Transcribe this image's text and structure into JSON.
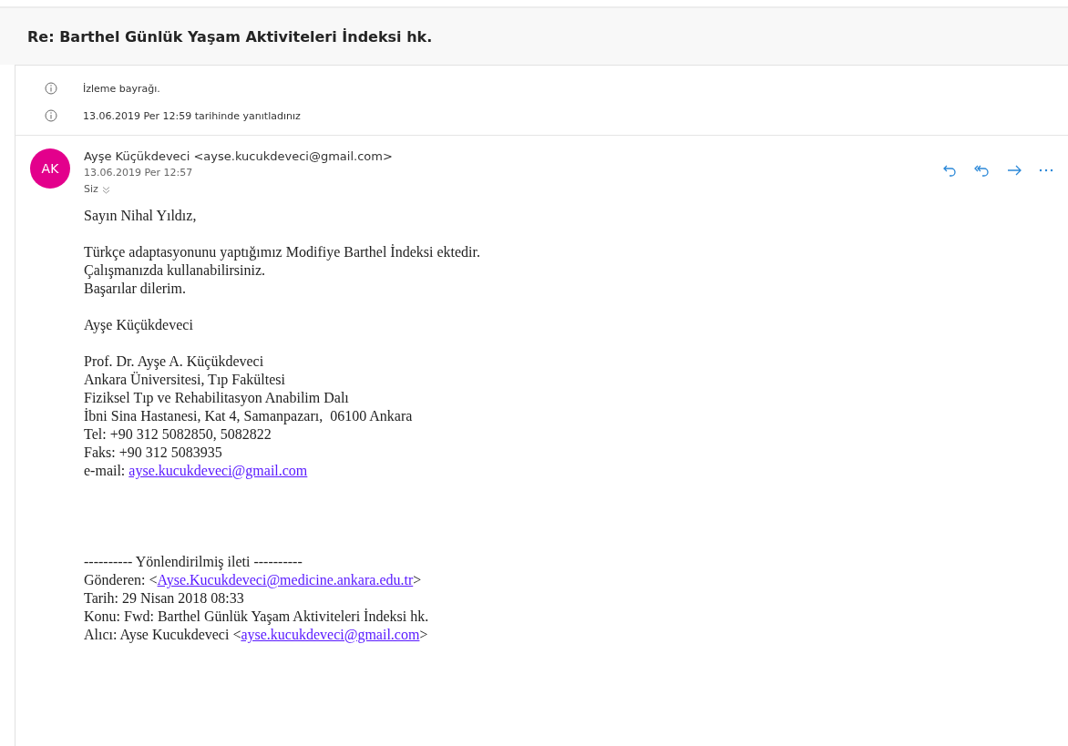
{
  "subject": "Re: Barthel Günlük Yaşam Aktiviteleri İndeksi hk.",
  "notices": [
    "İzleme bayrağı.",
    "13.06.2019 Per 12:59 tarihinde yanıtladınız"
  ],
  "message": {
    "initials": "AK",
    "sender": "Ayşe Küçükdeveci <ayse.kucukdeveci@gmail.com>",
    "date": "13.06.2019 Per 12:57",
    "recipient": "Siz",
    "paragraphs": [
      {
        "kind": "text",
        "lines": [
          {
            "text": "Sayın Nihal Yıldız,"
          }
        ]
      },
      {
        "kind": "text",
        "lines": [
          {
            "text": "Türkçe adaptasyonunu yaptığımız Modifiye Barthel İndeksi ektedir."
          },
          {
            "text": "Çalışmanızda kullanabilirsiniz."
          },
          {
            "text": "Başarılar dilerim."
          }
        ]
      },
      {
        "kind": "text",
        "lines": [
          {
            "text": "Ayşe Küçükdeveci"
          }
        ]
      },
      {
        "kind": "text",
        "lines": [
          {
            "text": "Prof. Dr. Ayşe A. Küçükdeveci"
          },
          {
            "text": "Ankara Üniversitesi, Tıp Fakültesi"
          },
          {
            "text": "Fiziksel Tıp ve Rehabilitasyon Anabilim Dalı"
          },
          {
            "text": "İbni Sina Hastanesi, Kat 4, Samanpazarı,  06100 Ankara"
          },
          {
            "text": "Tel: +90 312 5082850, 5082822"
          },
          {
            "text": "Faks: +90 312 5083935"
          },
          {
            "text": "e-mail: ",
            "link": "ayse.kucukdeveci@gmail.com"
          }
        ]
      },
      {
        "kind": "forwarded",
        "lines": [
          {
            "text": "---------- Yönlendirilmiş ileti ----------"
          },
          {
            "text": "Gönderen: <",
            "link": "Ayse.Kucukdeveci@medicine.ankara.edu.tr",
            "after": ">"
          },
          {
            "text": "Tarih: 29 Nisan 2018 08:33"
          },
          {
            "text": "Konu: Fwd: Barthel Günlük Yaşam Aktiviteleri İndeksi hk."
          },
          {
            "text": "Alıcı: Ayse Kucukdeveci <",
            "link": "ayse.kucukdeveci@gmail.com",
            "after": ">"
          }
        ]
      }
    ]
  }
}
